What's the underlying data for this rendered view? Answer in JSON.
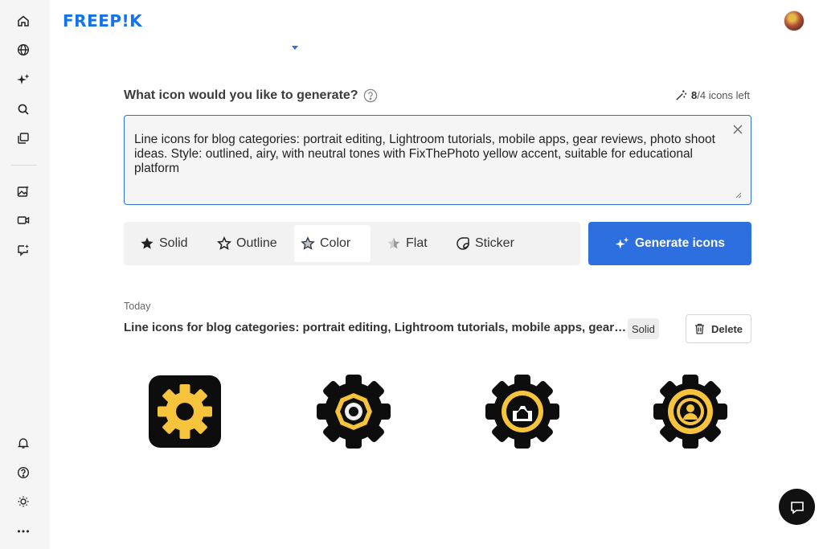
{
  "brand": {
    "logo_text": "FREEP!K",
    "accent": "#1273eb"
  },
  "sidebar": {
    "top_items": [
      {
        "name": "home-icon",
        "label": "Home"
      },
      {
        "name": "globe-icon",
        "label": "Explore"
      },
      {
        "name": "sparkles-icon",
        "label": "AI tools"
      },
      {
        "name": "search-icon",
        "label": "Search"
      },
      {
        "name": "collections-icon",
        "label": "Collections"
      }
    ],
    "mid_items": [
      {
        "name": "image-generator-icon",
        "label": "Image generator"
      },
      {
        "name": "video-icon",
        "label": "Video"
      },
      {
        "name": "chat-sparkle-icon",
        "label": "Assistant"
      }
    ],
    "bottom_items": [
      {
        "name": "bell-icon",
        "label": "Notifications"
      },
      {
        "name": "help-circle-icon",
        "label": "Help"
      },
      {
        "name": "sun-icon",
        "label": "Theme"
      },
      {
        "name": "more-icon",
        "label": "More"
      }
    ]
  },
  "generator": {
    "question": "What icon would you like to generate?",
    "credits_used": "8",
    "credits_rest": "/4 icons left",
    "prompt": "Line icons for blog categories: portrait editing, Lightroom tutorials, mobile apps, gear reviews, photo shoot ideas. Style: outlined, airy, with neutral tones with FixThePhoto yellow accent, suitable for educational platform",
    "styles": [
      {
        "label": "Solid",
        "icon": "solid-star-icon"
      },
      {
        "label": "Outline",
        "icon": "outline-star-icon"
      },
      {
        "label": "Color",
        "icon": "color-star-icon",
        "active": true
      },
      {
        "label": "Flat",
        "icon": "flat-star-icon"
      },
      {
        "label": "Sticker",
        "icon": "sticker-icon"
      }
    ],
    "generate_label": "Generate icons",
    "button_color": "#2e6fe0"
  },
  "history": {
    "day_label": "Today",
    "title": "Line icons for blog categories: portrait editing, Lightroom tutorials, mobile apps, gear reviews, photo shoot ideas. Style: outlined, airy, with neutral tones with FixThePhoto yellow accent, suitable for educational platform",
    "style_tag": "Solid",
    "delete_label": "Delete",
    "results": [
      {
        "name": "gear-square-icon"
      },
      {
        "name": "gear-aperture-icon"
      },
      {
        "name": "gear-camera-icon"
      },
      {
        "name": "gear-user-icon"
      }
    ],
    "icon_colors": {
      "dark": "#0d0d0d",
      "accent": "#f6c43c"
    }
  }
}
